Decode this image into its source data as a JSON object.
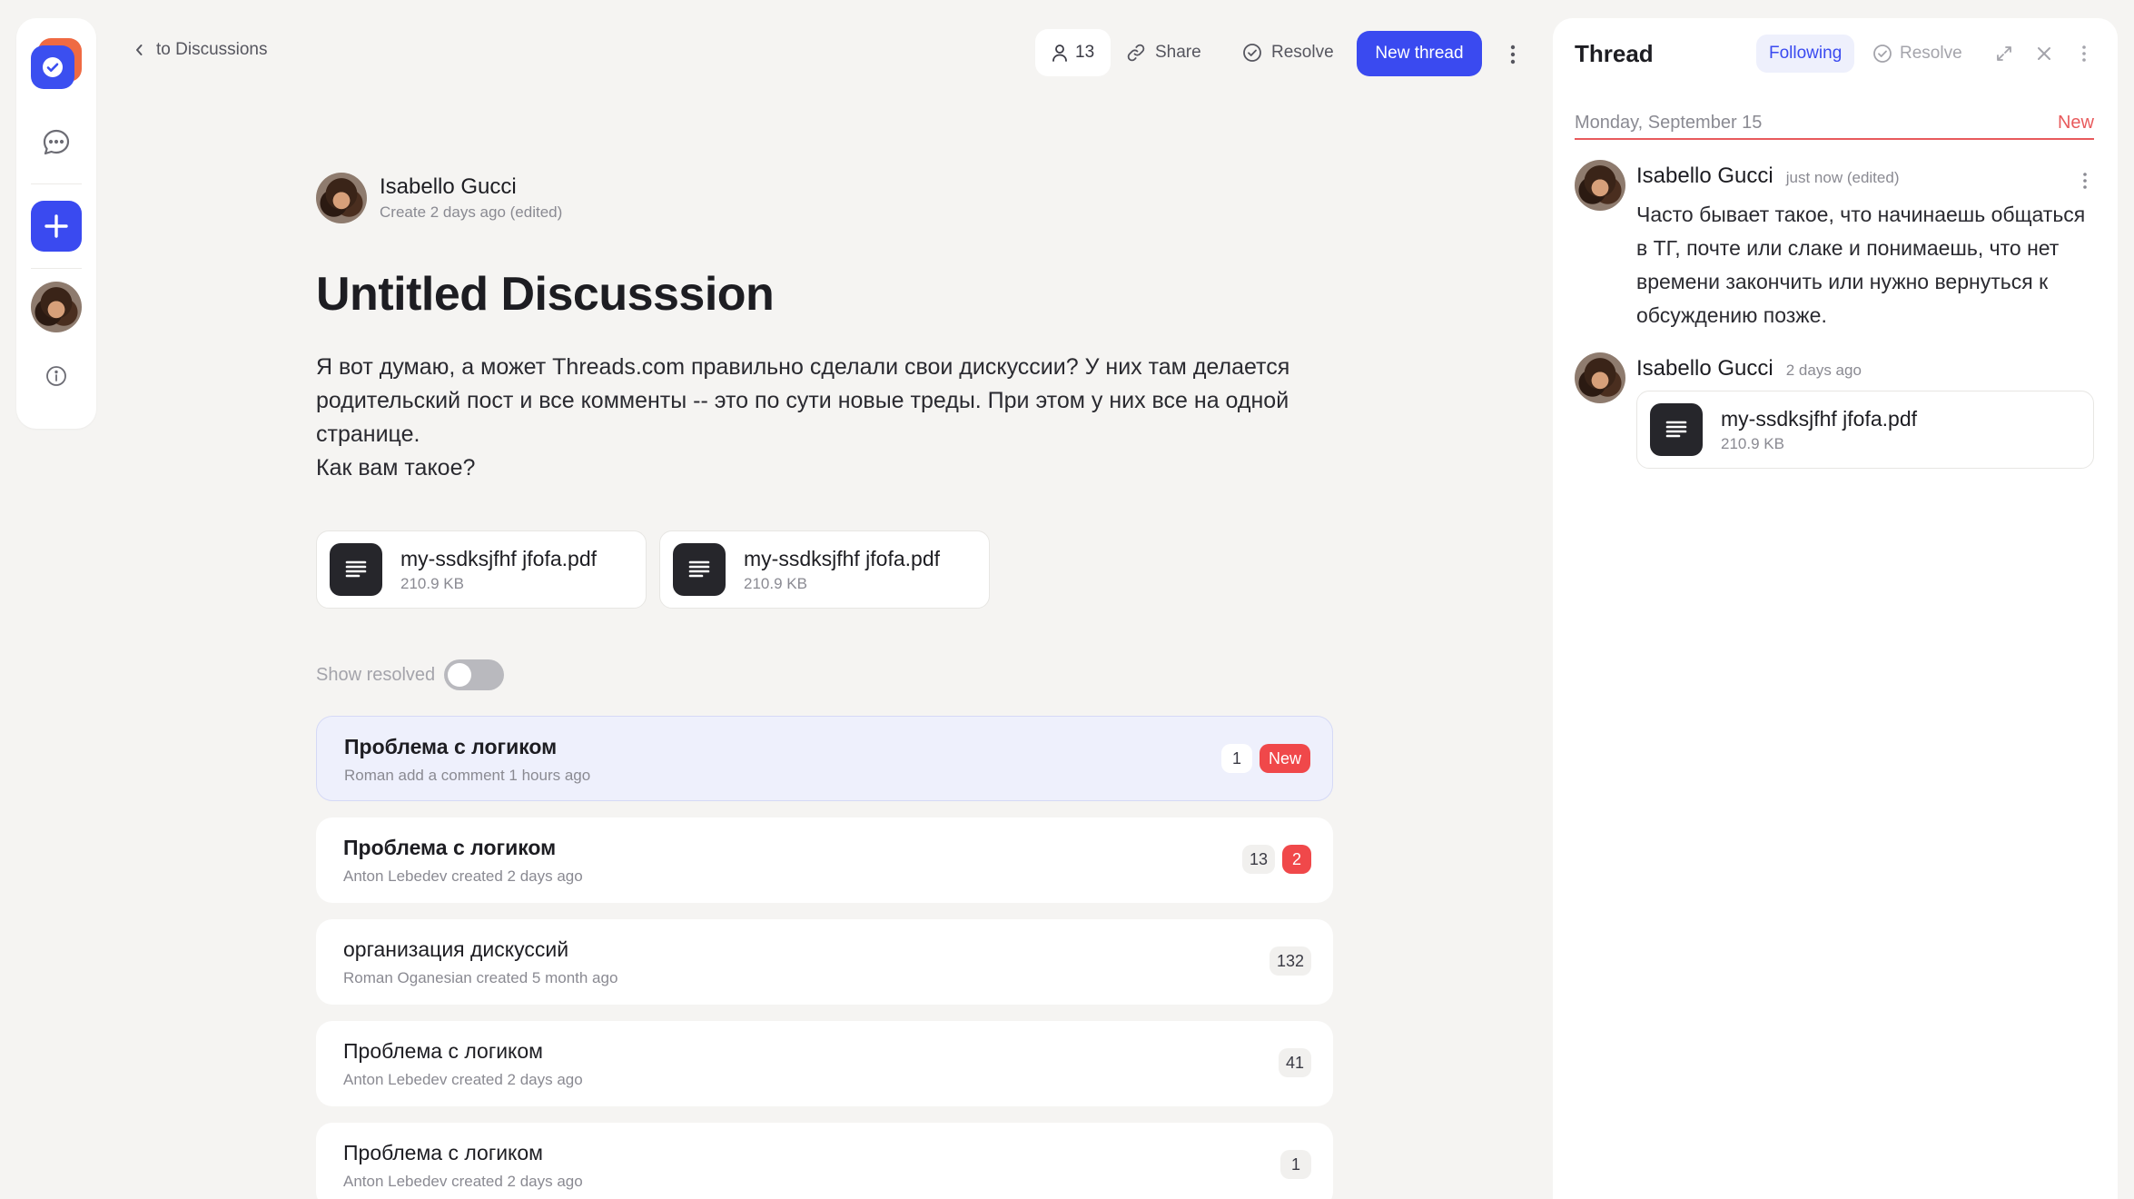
{
  "nav": {
    "back_label": "to Discussions"
  },
  "toolbar": {
    "members_count": "13",
    "share_label": "Share",
    "resolve_label": "Resolve",
    "new_thread_label": "New thread"
  },
  "post": {
    "author_name": "Isabello Gucci",
    "meta": "Create 2 days ago  (edited)",
    "title": "Untitled Discusssion",
    "body": [
      "Я вот думаю, а может Threads.com правильно сделали свои дискуссии? У них там делается родительский пост и все комменты -- это по сути новые треды. При этом у них все на одной странице.",
      "Как вам такое?"
    ],
    "attachments": [
      {
        "name": "my-ssdksjfhf jfofa.pdf",
        "size": "210.9 KB"
      },
      {
        "name": "my-ssdksjfhf jfofa.pdf",
        "size": "210.9 KB"
      }
    ]
  },
  "filter": {
    "show_resolved_label": "Show resolved"
  },
  "threads": [
    {
      "title": "Проблема с логиком",
      "meta": "Roman add a comment 1 hours ago",
      "count": "1",
      "new_label": "New",
      "unread": ""
    },
    {
      "title": "Проблема с логиком",
      "meta": "Anton Lebedev created 2 days ago",
      "count": "13",
      "new_label": "",
      "unread": "2"
    },
    {
      "title": "организация дискуссий",
      "meta": "Roman Oganesian created 5 month ago",
      "count": "132",
      "new_label": "",
      "unread": ""
    },
    {
      "title": "Проблема с логиком",
      "meta": "Anton Lebedev created 2 days ago",
      "count": "41",
      "new_label": "",
      "unread": ""
    },
    {
      "title": "Проблема с логиком",
      "meta": "Anton Lebedev created 2 days ago",
      "count": "1",
      "new_label": "",
      "unread": ""
    }
  ],
  "panel": {
    "title": "Thread",
    "following_label": "Following",
    "resolve_label": "Resolve",
    "date_label": "Monday, September 15",
    "new_label": "New",
    "messages": [
      {
        "author": "Isabello Gucci",
        "time": "just now  (edited)",
        "text": "Часто бывает такое, что начинаешь общаться в ТГ, почте или слаке и понимаешь, что нет времени закончить или нужно вернуться к обсуждению позже."
      },
      {
        "author": "Isabello Gucci",
        "time": "2 days ago",
        "file_name": "my-ssdksjfhf jfofa.pdf",
        "file_size": "210.9 KB"
      }
    ]
  },
  "icons": {
    "logo": "check-logo-icon",
    "chat": "chat-bubbles-icon",
    "add": "plus-icon",
    "info": "info-icon",
    "members": "user-icon",
    "share": "link-icon",
    "resolve": "check-circle-icon",
    "more": "more-vertical-icon",
    "expand": "expand-icon",
    "close": "close-icon",
    "file": "document-icon"
  },
  "colors": {
    "accent": "#3a4af0",
    "danger": "#f0484a",
    "background": "#f5f4f2"
  }
}
